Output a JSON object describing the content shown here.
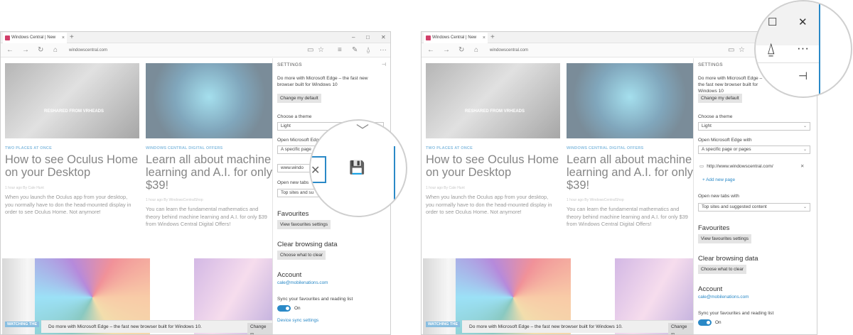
{
  "browser": {
    "tab_title": "Windows Central | New",
    "tab_close": "×",
    "new_tab": "+",
    "url": "windowscentral.com",
    "win_minimize": "–",
    "win_maximize": "□",
    "win_close": "✕",
    "nav_back": "←",
    "nav_forward": "→",
    "nav_refresh": "↻",
    "nav_home": "⌂",
    "reading_view": "▭",
    "favorite_star": "☆",
    "hub": "≡",
    "notes": "✎",
    "share": "⍙",
    "more": "···"
  },
  "articles": [
    {
      "kicker": "TWO PLACES AT ONCE",
      "headline": "How to see Oculus Home on your Desktop",
      "meta": "1 hour ago   By Cale Hunt",
      "body": "When you launch the Oculus app from your desktop, you normally have to don the head-mounted display in order to see Oculus Home. Not anymore!",
      "image_caption": "RESHARED FROM VRHEADS"
    },
    {
      "kicker": "WINDOWS CENTRAL DIGITAL OFFERS",
      "headline": "Learn all about machine learning and A.I. for only $39!",
      "meta": "1 hour ago   By WindowsCentralShop",
      "body": "You can learn the fundamental mathematics and theory behind machine learning and A.I. for only $39 from Windows Central Digital Offers!"
    }
  ],
  "watching_label": "WATCHING THE",
  "watching_label_right": "WATCHING THE",
  "settings": {
    "title": "SETTINGS",
    "pin": "⊣",
    "promo": "Do more with Microsoft Edge – the fast new browser built for Windows 10",
    "change_default": "Change my default",
    "theme_label": "Choose a theme",
    "theme_value": "Light",
    "open_with_label": "Open Microsoft Edge with",
    "open_with_value": "A specific page or pages",
    "open_with_value_partial": "A specific page",
    "open_with_label_partial": "Open Microsoft Edg",
    "page_url": "http://www.windowscentral.com/",
    "page_url_partial": "www.windo",
    "add_page": "+  Add new page",
    "new_tabs_label": "Open new tabs with",
    "new_tabs_label_partial": "Open new tabs",
    "new_tabs_value": "Top sites and suggested content",
    "new_tabs_value_partial": "Top sites and su",
    "favourites_head": "Favourites",
    "view_favourites": "View favourites settings",
    "clear_head": "Clear browsing data",
    "choose_clear": "Choose what to clear",
    "account_head": "Account",
    "account_email": "cale@mobilenations.com",
    "sync_label": "Sync your favourites and reading list",
    "sync_state": "On",
    "device_sync": "Device sync settings",
    "remove_x": "✕"
  },
  "banner": {
    "text": "Do more with Microsoft Edge – the fast new browser built for Windows 10.",
    "button": "Change m"
  },
  "magnifier_left": {
    "chevron": "﹀",
    "close": "✕",
    "save": "💾"
  },
  "magnifier_right": {
    "maximize": "☐",
    "close": "✕",
    "share_icon": "⍙",
    "more": "···",
    "pin": "⊣"
  },
  "colors": {
    "accent": "#2a89c7",
    "favicon": "#d13f6a"
  }
}
